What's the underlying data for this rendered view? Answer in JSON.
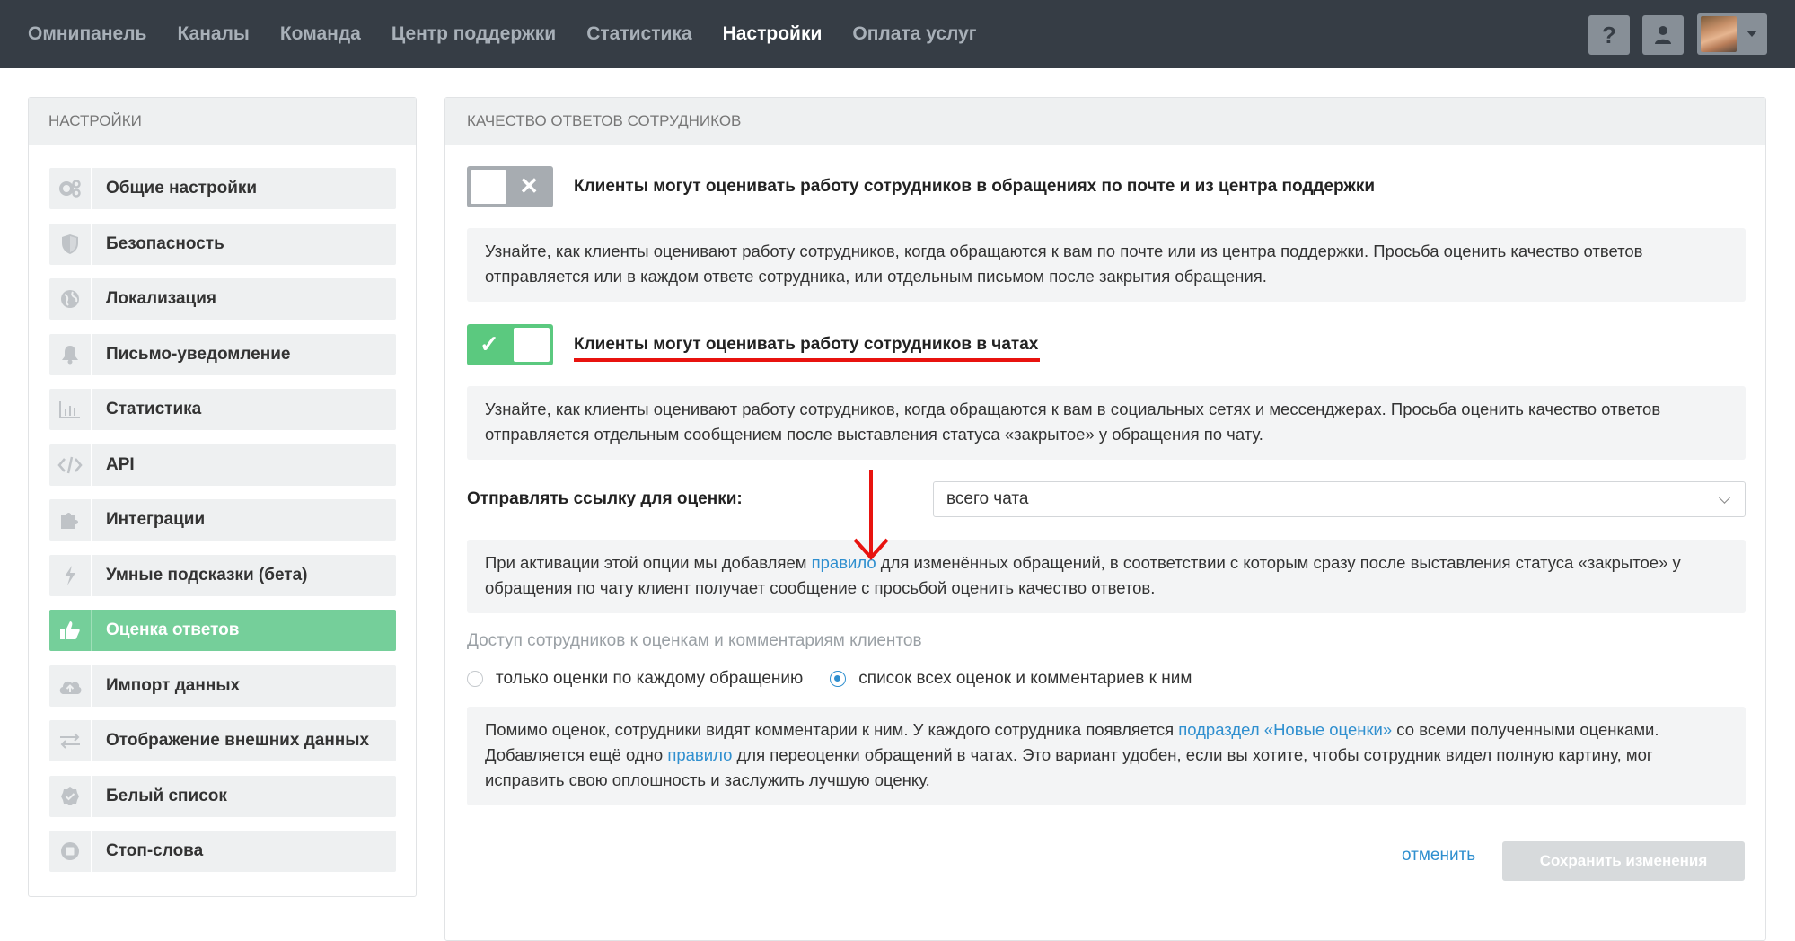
{
  "nav": {
    "items": [
      {
        "label": "Омнипанель",
        "active": false
      },
      {
        "label": "Каналы",
        "active": false
      },
      {
        "label": "Команда",
        "active": false
      },
      {
        "label": "Центр поддержки",
        "active": false
      },
      {
        "label": "Статистика",
        "active": false
      },
      {
        "label": "Настройки",
        "active": true
      },
      {
        "label": "Оплата услуг",
        "active": false
      }
    ],
    "help_label": "?"
  },
  "sidebar": {
    "title": "НАСТРОЙКИ",
    "items": [
      {
        "label": "Общие настройки",
        "icon": "gears-icon",
        "active": false
      },
      {
        "label": "Безопасность",
        "icon": "shield-icon",
        "active": false
      },
      {
        "label": "Локализация",
        "icon": "globe-icon",
        "active": false
      },
      {
        "label": "Письмо-уведомление",
        "icon": "bell-icon",
        "active": false
      },
      {
        "label": "Статистика",
        "icon": "bar-chart-icon",
        "active": false
      },
      {
        "label": "API",
        "icon": "code-icon",
        "active": false
      },
      {
        "label": "Интеграции",
        "icon": "puzzle-icon",
        "active": false
      },
      {
        "label": "Умные подсказки (бета)",
        "icon": "lightning-icon",
        "active": false
      },
      {
        "label": "Оценка ответов",
        "icon": "thumbs-up-icon",
        "active": true
      },
      {
        "label": "Импорт данных",
        "icon": "cloud-upload-icon",
        "active": false
      },
      {
        "label": "Отображение внешних данных",
        "icon": "arrows-exchange-icon",
        "active": false
      },
      {
        "label": "Белый список",
        "icon": "badge-check-icon",
        "active": false
      },
      {
        "label": "Стоп-слова",
        "icon": "stop-icon",
        "active": false
      }
    ]
  },
  "main": {
    "title": "КАЧЕСТВО ОТВЕТОВ СОТРУДНИКОВ",
    "toggle_email": {
      "state": "off",
      "label": "Клиенты могут оценивать работу сотрудников в обращениях по почте и из центра поддержки",
      "info": "Узнайте, как клиенты оценивают работу сотрудников, когда обращаются к вам по почте или из центра поддержки. Просьба оценить качество ответов отправляется или в каждом ответе сотрудника, или отдельным письмом после закрытия обращения."
    },
    "toggle_chat": {
      "state": "on",
      "label": "Клиенты могут оценивать работу сотрудников в чатах",
      "info": "Узнайте, как клиенты оценивают работу сотрудников, когда обращаются к вам в социальных сетях и мессенджерах. Просьба оценить качество ответов отправляется отдельным сообщением после выставления статуса «закрытое» у обращения по чату."
    },
    "send_link": {
      "label": "Отправлять ссылку для оценки:",
      "selected": "всего чата"
    },
    "activation_info": {
      "before": "При активации этой опции мы добавляем ",
      "link": "правило",
      "after": " для изменённых обращений, в соответствии с которым сразу после выставления статуса «закрытое» у обращения по чату клиент получает сообщение с просьбой оценить качество ответов."
    },
    "access": {
      "title": "Доступ сотрудников к оценкам и комментариям клиентов",
      "options": [
        {
          "label": "только оценки по каждому обращению",
          "checked": false
        },
        {
          "label": "список всех оценок и комментариев к ним",
          "checked": true
        }
      ]
    },
    "access_info": {
      "part1": "Помимо оценок, сотрудники видят комментарии к ним. У каждого сотрудника появляется ",
      "link1": "подраздел «Новые оценки»",
      "part2": " со всеми полученными оценками. Добавляется ещё одно ",
      "link2": "правило",
      "part3": " для переоценки обращений в чатах. Это вариант удобен, если вы хотите, чтобы сотрудник видел полную картину, мог исправить свою оплошность и заслужить лучшую оценку."
    },
    "actions": {
      "cancel": "отменить",
      "save": "Сохранить изменения"
    }
  },
  "colors": {
    "topbar": "#363d45",
    "accent_green": "#75cf9a",
    "link_blue": "#2f8fcf",
    "annotation_red": "#e8130f"
  }
}
